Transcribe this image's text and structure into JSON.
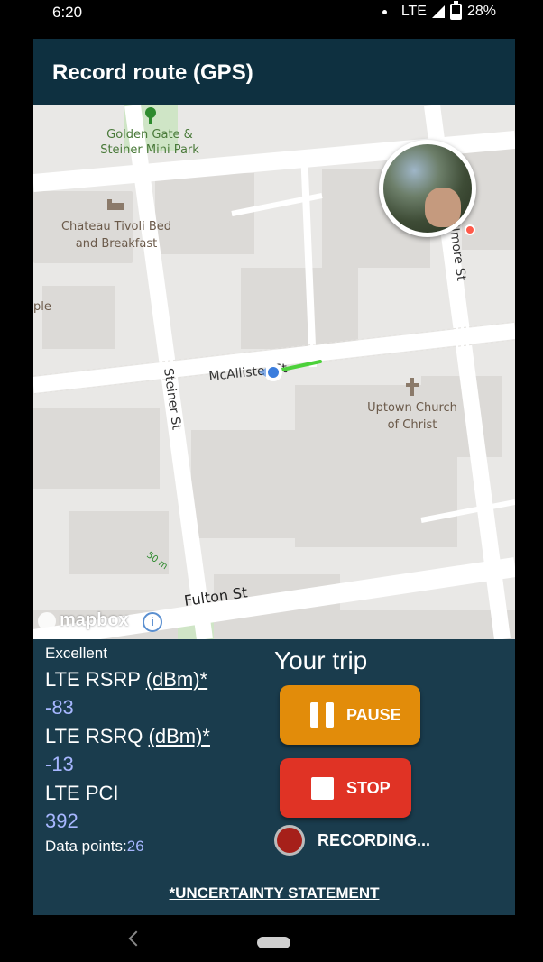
{
  "status_bar": {
    "time": "6:20",
    "network": "LTE",
    "battery": "28%"
  },
  "app_bar": {
    "title": "Record route (GPS)"
  },
  "map": {
    "labels": {
      "park": "Golden Gate & Steiner Mini Park",
      "hotel": "Chateau Tivoli Bed and Breakfast",
      "church": "Uptown Church of Christ",
      "edge": "ple",
      "street_mcallister": "McAllister St",
      "street_steiner": "Steiner St",
      "street_fillmore": "Fillmore St",
      "street_fulton": "Fulton St",
      "scale": "50 m"
    },
    "attribution": "mapbox",
    "route_color": "#4cd13a",
    "location_dot_color": "#3b7ddd"
  },
  "signal": {
    "quality": "Excellent",
    "rsrp_label": "LTE RSRP",
    "rsrp_unit": "(dBm)*",
    "rsrp_value": "-83",
    "rsrq_label": "LTE RSRQ",
    "rsrq_unit": "(dBm)*",
    "rsrq_value": "-13",
    "pci_label": "LTE PCI",
    "pci_value": "392",
    "data_points_label": "Data points:",
    "data_points_value": "26"
  },
  "trip": {
    "title": "Your trip",
    "pause_label": "PAUSE",
    "stop_label": "STOP",
    "recording_label": "RECORDING..."
  },
  "footer": {
    "uncertainty_link": "*UNCERTAINTY STATEMENT"
  },
  "colors": {
    "app_bar": "#0e3040",
    "panel": "#1a3c4d",
    "pause": "#e28c0a",
    "stop": "#e03325",
    "value_text": "#a7b7ff"
  }
}
